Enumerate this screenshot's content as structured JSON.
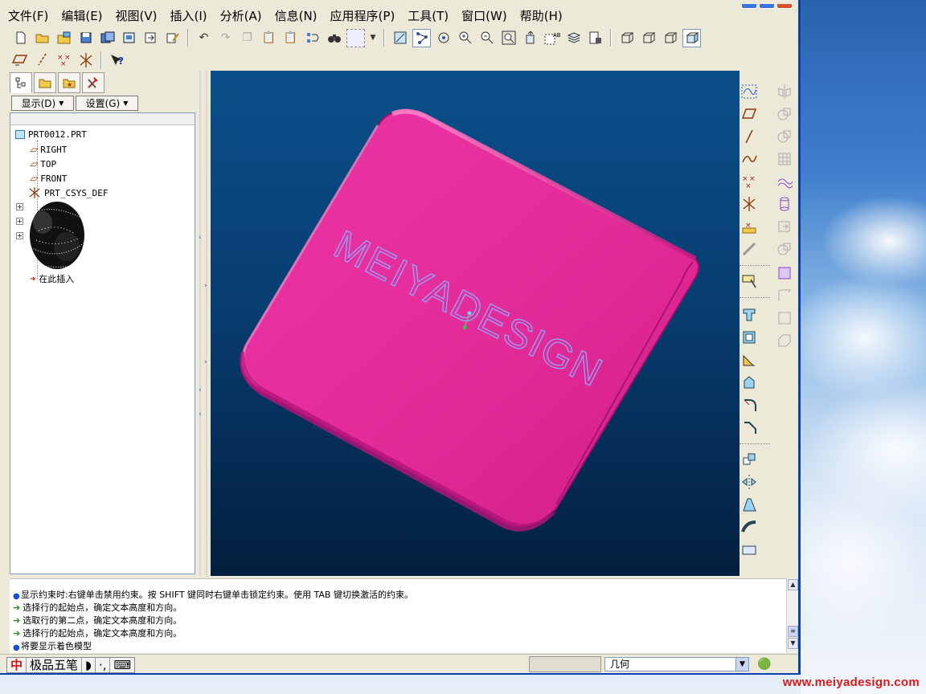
{
  "menu": [
    "文件(F)",
    "编辑(E)",
    "视图(V)",
    "插入(I)",
    "分析(A)",
    "信息(N)",
    "应用程序(P)",
    "工具(T)",
    "窗口(W)",
    "帮助(H)"
  ],
  "toolbar_row1_icons": [
    "new-icon",
    "open-icon",
    "open-session-icon",
    "save-icon",
    "save-copy-icon",
    "backup-icon",
    "rename-icon",
    "edit-icon",
    "undo-icon",
    "redo-icon",
    "copy-icon",
    "paste-icon",
    "paste-special-icon",
    "regenerate-icon",
    "find-icon",
    "select-box-icon",
    "dropdown-icon",
    "datum-display-icon",
    "datum-axis-icon",
    "spin-center-icon",
    "zoom-in-icon",
    "zoom-out-icon",
    "refit-icon",
    "reorient-icon",
    "view-manager-icon",
    "layer-icon",
    "saved-views-icon",
    "wireframe-icon",
    "hidden-line-icon",
    "no-hidden-icon",
    "shading-icon"
  ],
  "toolbar_row2_icons": [
    "plane-display-icon",
    "axis-display-icon",
    "point-display-icon",
    "csys-display-icon",
    "context-help-icon"
  ],
  "left_panel": {
    "show_label": "显示(D)",
    "settings_label": "设置(G)",
    "tree": {
      "root": "PRT0012.PRT",
      "items": [
        "RIGHT",
        "TOP",
        "FRONT",
        "PRT_CSYS_DEF"
      ],
      "insert_here": "在此插入"
    }
  },
  "viewport": {
    "model_text": "MEIYADESIGN",
    "model_color": "#e62a98",
    "background_top": "#0b4f8a",
    "background_bottom": "#041f3e"
  },
  "messages": [
    {
      "type": "info",
      "text": "显示约束时:右键单击禁用约束。按 SHIFT 键同时右键单击锁定约束。使用 TAB 键切换激活的约束。"
    },
    {
      "type": "prompt",
      "text": "选择行的起始点，确定文本高度和方向。"
    },
    {
      "type": "prompt",
      "text": "选取行的第二点，确定文本高度和方向。"
    },
    {
      "type": "prompt",
      "text": "选择行的起始点，确定文本高度和方向。"
    },
    {
      "type": "info",
      "text": "将要显示着色模型"
    }
  ],
  "status_bar": {
    "ime_name": "极品五笔",
    "filter_value": "几何"
  },
  "watermark": "www.meiyadesign.com"
}
